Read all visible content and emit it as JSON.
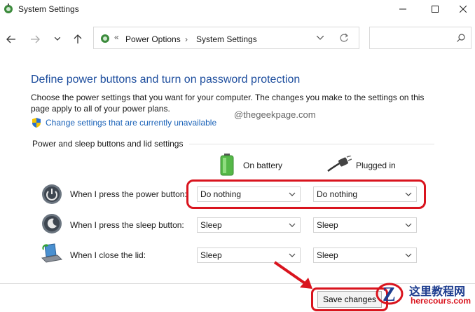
{
  "window": {
    "title": "System Settings"
  },
  "breadcrumb": {
    "separator": "«",
    "items": [
      "Power Options",
      "System Settings"
    ]
  },
  "search": {
    "placeholder": ""
  },
  "main": {
    "heading": "Define power buttons and turn on password protection",
    "description": "Choose the power settings that you want for your computer. The changes you make to the settings on this page apply to all of your power plans.",
    "change_link": "Change settings that are currently unavailable",
    "watermark": "@thegeekpage.com",
    "section_label": "Power and sleep buttons and lid settings"
  },
  "columns": {
    "battery": "On battery",
    "plugged": "Plugged in"
  },
  "rows": [
    {
      "label": "When I press the power button:",
      "battery": "Do nothing",
      "plugged": "Do nothing"
    },
    {
      "label": "When I press the sleep button:",
      "battery": "Sleep",
      "plugged": "Sleep"
    },
    {
      "label": "When I close the lid:",
      "battery": "Sleep",
      "plugged": "Sleep"
    }
  ],
  "save_button": "Save changes",
  "brand": {
    "name": "这里教程网",
    "url": "herecours.com"
  },
  "colors": {
    "accent": "#1e4e9e",
    "link": "#1a62b8",
    "highlight": "#d9141e"
  }
}
